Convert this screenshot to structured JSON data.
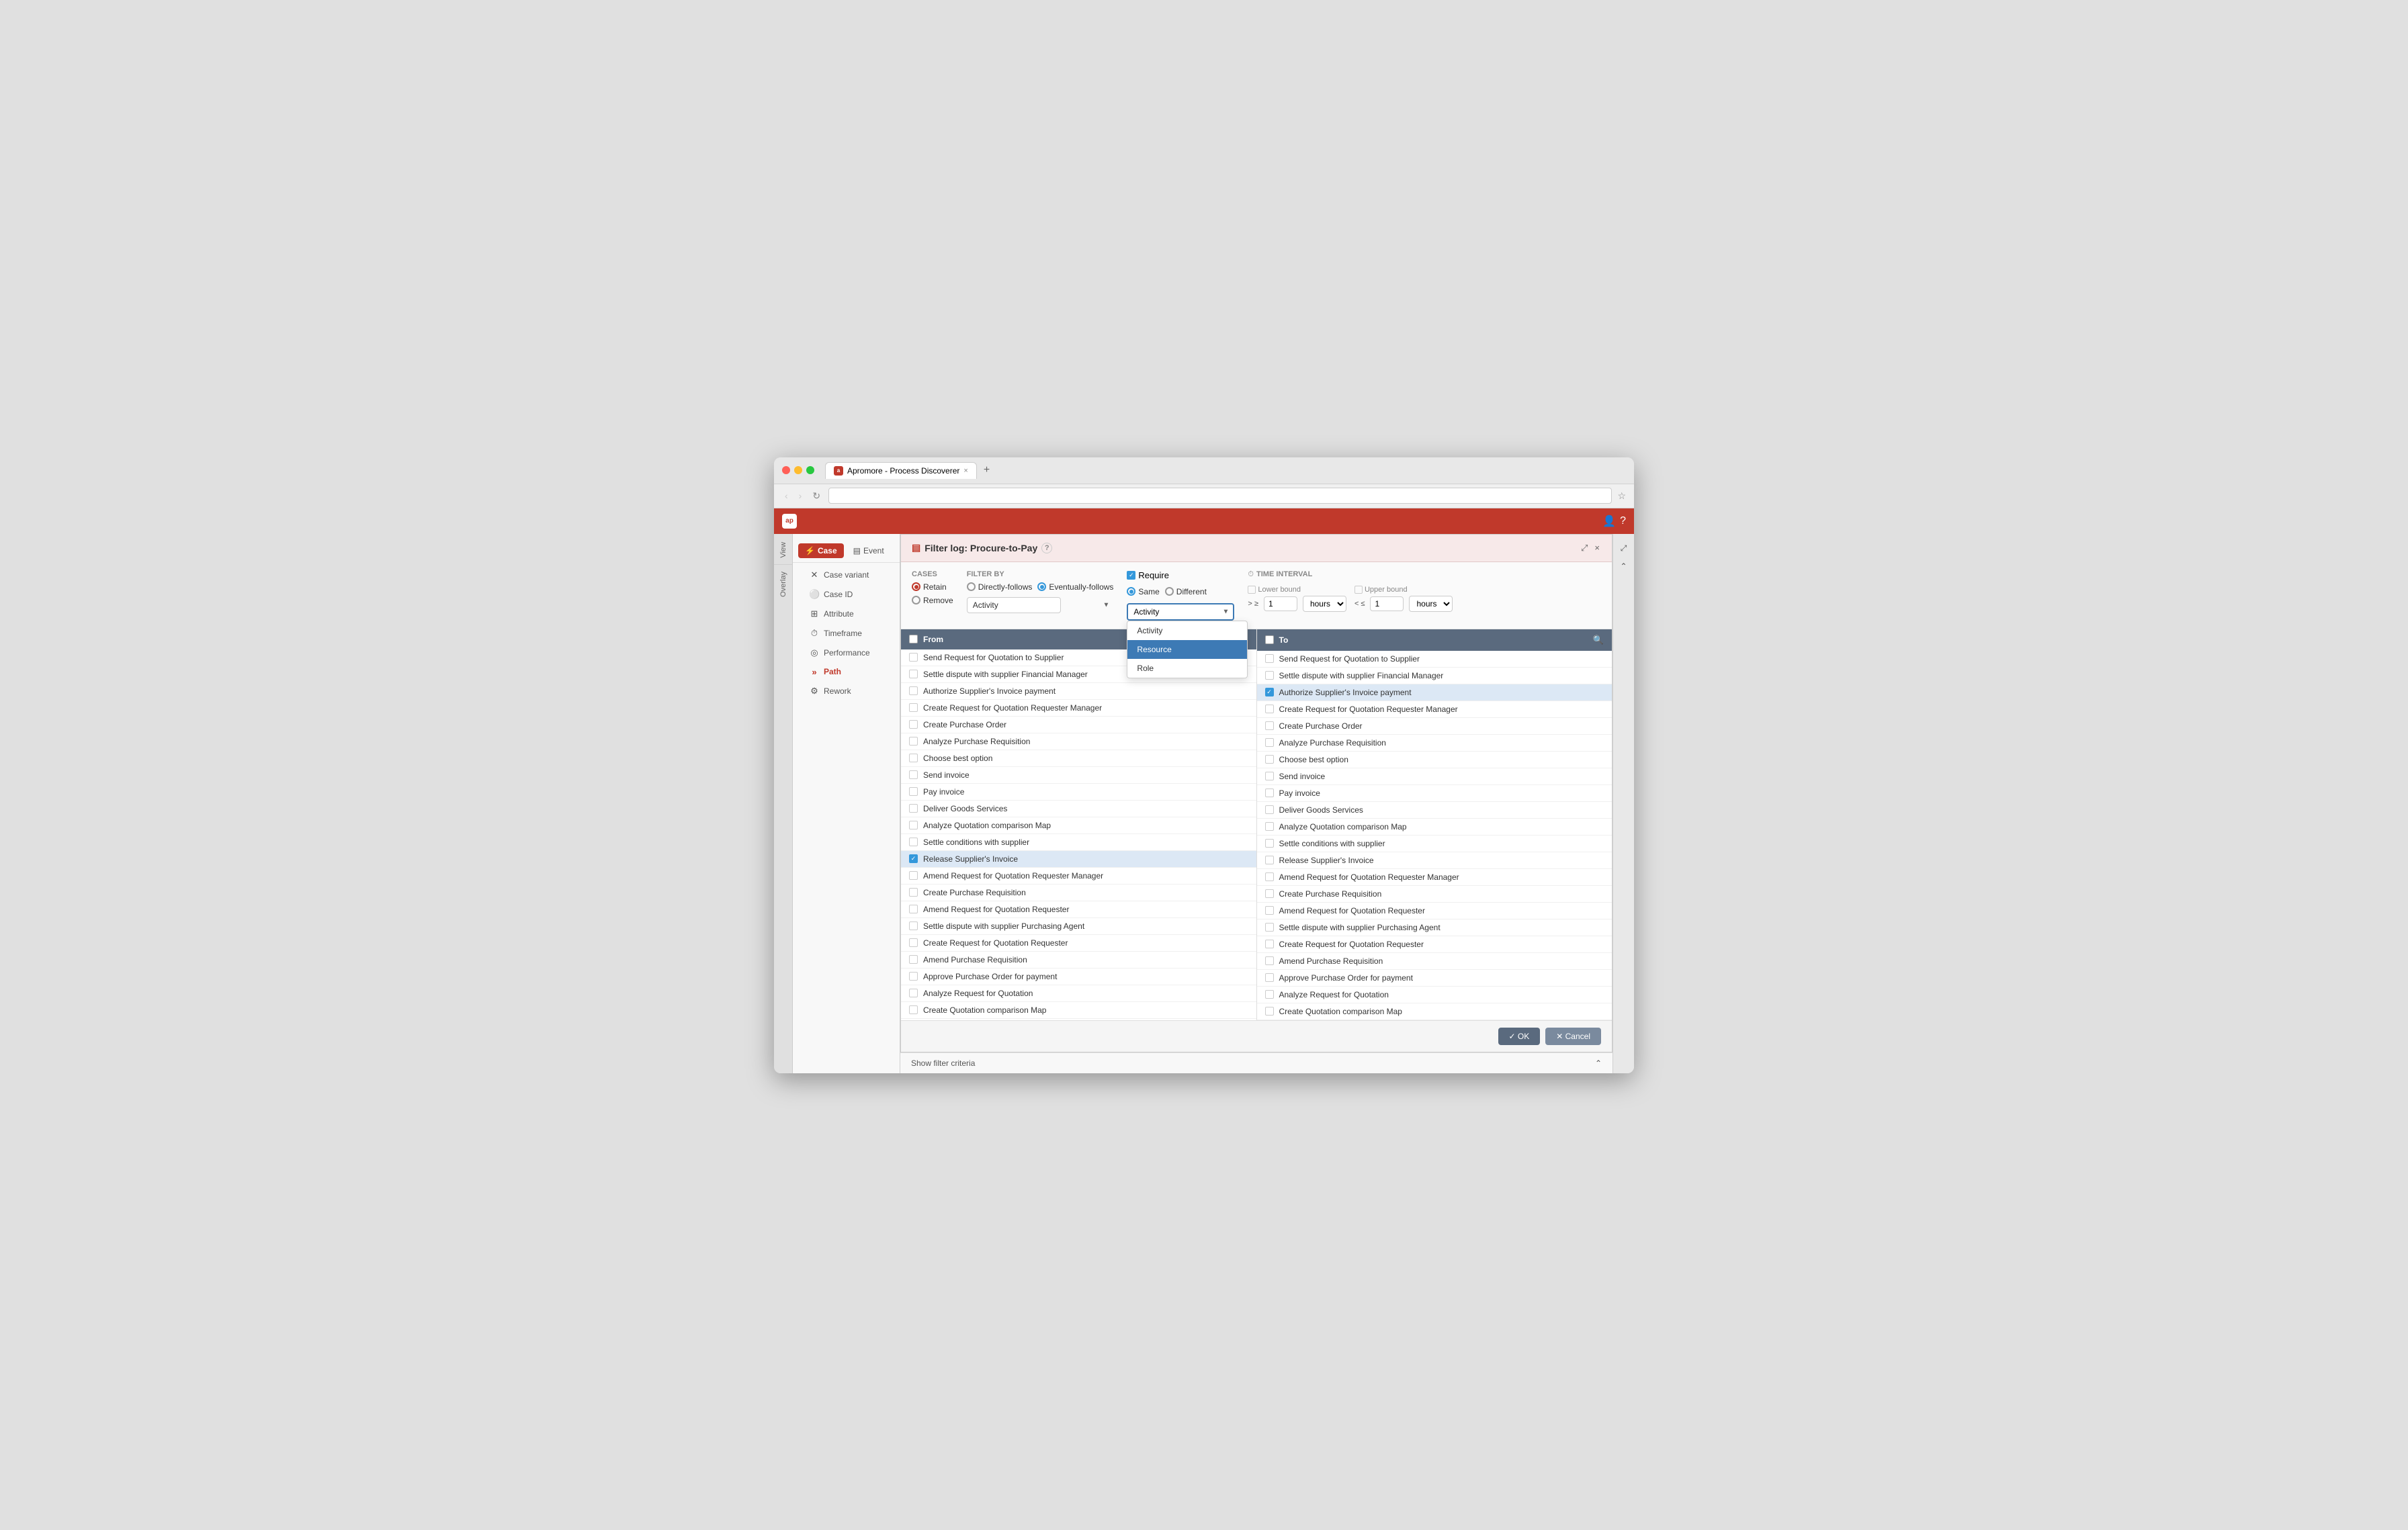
{
  "browser": {
    "tab_title": "Apromore - Process Discoverer",
    "tab_close": "×",
    "new_tab": "+",
    "url": "",
    "nav_back": "‹",
    "nav_forward": "›",
    "nav_reload": "↻"
  },
  "app": {
    "logo": "ap",
    "title": "Apromore"
  },
  "sidebar_tabs": {
    "view_label": "View",
    "overlay_label": "Overlay"
  },
  "left_nav": {
    "sections": [
      {
        "label": "Case",
        "icon": "⚡",
        "active": true,
        "type": "case"
      },
      {
        "label": "Event",
        "icon": "▤",
        "type": "event"
      }
    ],
    "items": [
      {
        "label": "Case variant",
        "icon": "✕",
        "active": false
      },
      {
        "label": "Case ID",
        "icon": "⚪",
        "active": false
      },
      {
        "label": "Attribute",
        "icon": "⊞",
        "active": false
      },
      {
        "label": "Timeframe",
        "icon": "⏱",
        "active": false
      },
      {
        "label": "Performance",
        "icon": "◎",
        "active": false
      },
      {
        "label": "Path",
        "icon": "»",
        "active": true
      },
      {
        "label": "Rework",
        "icon": "⚙",
        "active": false
      }
    ]
  },
  "dialog": {
    "title": "Filter log: Procure-to-Pay",
    "help_icon": "?",
    "expand_icon": "⤢",
    "close_icon": "×"
  },
  "toolbar": {
    "cases_label": "Cases",
    "retain_label": "Retain",
    "remove_label": "Remove",
    "filter_by_label": "Filter by",
    "activity_option": "Activity",
    "directly_follows_label": "Directly-follows",
    "eventually_follows_label": "Eventually-follows",
    "require_label": "Require",
    "same_label": "Same",
    "different_label": "Different",
    "activity_dropdown_label": "Activity",
    "time_interval_label": "Time interval",
    "lower_bound_label": "Lower bound",
    "upper_bound_label": "Upper bound",
    "gte_symbol": "> ≥",
    "lte_symbol": "< ≤",
    "lower_value": "1",
    "upper_value": "1",
    "lower_unit": "hours",
    "upper_unit": "hours"
  },
  "filter_by_dropdown": {
    "items": [
      {
        "label": "Activity",
        "highlighted": false
      },
      {
        "label": "Resource",
        "highlighted": true
      },
      {
        "label": "Role",
        "highlighted": false
      }
    ]
  },
  "from_table": {
    "header": "From",
    "rows": [
      {
        "label": "Send Request for Quotation to Supplier",
        "checked": false
      },
      {
        "label": "Settle dispute with supplier Financial Manager",
        "checked": false
      },
      {
        "label": "Authorize Supplier's Invoice payment",
        "checked": false
      },
      {
        "label": "Create Request for Quotation Requester Manager",
        "checked": false
      },
      {
        "label": "Create Purchase Order",
        "checked": false
      },
      {
        "label": "Analyze Purchase Requisition",
        "checked": false
      },
      {
        "label": "Choose best option",
        "checked": false
      },
      {
        "label": "Send invoice",
        "checked": false
      },
      {
        "label": "Pay invoice",
        "checked": false
      },
      {
        "label": "Deliver Goods Services",
        "checked": false
      },
      {
        "label": "Analyze Quotation comparison Map",
        "checked": false
      },
      {
        "label": "Settle conditions with supplier",
        "checked": false
      },
      {
        "label": "Release Supplier's Invoice",
        "checked": true,
        "selected": true
      },
      {
        "label": "Amend Request for Quotation Requester Manager",
        "checked": false
      },
      {
        "label": "Create Purchase Requisition",
        "checked": false
      },
      {
        "label": "Amend Request for Quotation Requester",
        "checked": false
      },
      {
        "label": "Settle dispute with supplier Purchasing Agent",
        "checked": false
      },
      {
        "label": "Create Request for Quotation Requester",
        "checked": false
      },
      {
        "label": "Amend Purchase Requisition",
        "checked": false
      },
      {
        "label": "Approve Purchase Order for payment",
        "checked": false
      },
      {
        "label": "Analyze Request for Quotation",
        "checked": false
      },
      {
        "label": "Create Quotation comparison Map",
        "checked": false
      }
    ]
  },
  "to_table": {
    "header": "To",
    "search_icon": "🔍",
    "rows": [
      {
        "label": "Send Request for Quotation to Supplier",
        "checked": false
      },
      {
        "label": "Settle dispute with supplier Financial Manager",
        "checked": false
      },
      {
        "label": "Authorize Supplier's Invoice payment",
        "checked": true,
        "selected": true
      },
      {
        "label": "Create Request for Quotation Requester Manager",
        "checked": false
      },
      {
        "label": "Create Purchase Order",
        "checked": false
      },
      {
        "label": "Analyze Purchase Requisition",
        "checked": false
      },
      {
        "label": "Choose best option",
        "checked": false
      },
      {
        "label": "Send invoice",
        "checked": false
      },
      {
        "label": "Pay invoice",
        "checked": false
      },
      {
        "label": "Deliver Goods Services",
        "checked": false
      },
      {
        "label": "Analyze Quotation comparison Map",
        "checked": false
      },
      {
        "label": "Settle conditions with supplier",
        "checked": false
      },
      {
        "label": "Release Supplier's Invoice",
        "checked": false
      },
      {
        "label": "Amend Request for Quotation Requester Manager",
        "checked": false
      },
      {
        "label": "Create Purchase Requisition",
        "checked": false
      },
      {
        "label": "Amend Request for Quotation Requester",
        "checked": false
      },
      {
        "label": "Settle dispute with supplier Purchasing Agent",
        "checked": false
      },
      {
        "label": "Create Request for Quotation Requester",
        "checked": false
      },
      {
        "label": "Amend Purchase Requisition",
        "checked": false
      },
      {
        "label": "Approve Purchase Order for payment",
        "checked": false
      },
      {
        "label": "Analyze Request for Quotation",
        "checked": false
      },
      {
        "label": "Create Quotation comparison Map",
        "checked": false
      }
    ]
  },
  "footer": {
    "ok_label": "✓ OK",
    "cancel_label": "✕ Cancel",
    "filter_criteria_label": "Show filter criteria",
    "collapse_icon": "⌃"
  }
}
